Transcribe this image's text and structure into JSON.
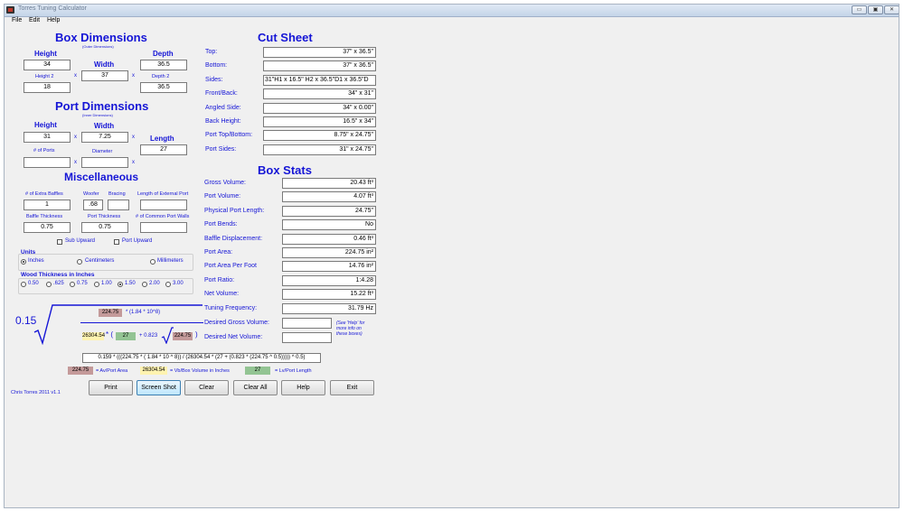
{
  "window": {
    "title": "Torres Tuning Calculator"
  },
  "menu": {
    "file": "File",
    "edit": "Edit",
    "help": "Help"
  },
  "box_dimensions": {
    "title": "Box Dimensions",
    "subtitle": "(Outer Dimensions)",
    "height_label": "Height",
    "height": "34",
    "width_label": "Width",
    "width": "37",
    "depth_label": "Depth",
    "depth": "36.5",
    "height2_label": "Height 2",
    "height2": "18",
    "depth2_label": "Depth 2",
    "depth2": "36.5",
    "x": "x"
  },
  "port_dimensions": {
    "title": "Port Dimensions",
    "subtitle": "(Inner Dimensions)",
    "height_label": "Height",
    "height": "31",
    "width_label": "Width",
    "width": "7.25",
    "length_label": "Length",
    "length": "27",
    "num_ports_label": "# of Ports",
    "num_ports": "",
    "diameter_label": "Diameter",
    "diameter": ""
  },
  "misc": {
    "title": "Miscellaneous",
    "extra_baffles_label": "# of Extra Baffles",
    "extra_baffles": "1",
    "woofer_label": "Woofer",
    "woofer": ".68",
    "bracing_label": "Bracing",
    "bracing": "",
    "ext_port_label": "Length of External Port",
    "ext_port": "",
    "baffle_thick_label": "Baffle Thickness",
    "baffle_thick": "0.75",
    "port_thick_label": "Port Thickness",
    "port_thick": "0.75",
    "common_walls_label": "# of Common Port Walls",
    "common_walls": "",
    "sub_upward": "Sub Upward",
    "port_upward": "Port Upward"
  },
  "units": {
    "title": "Units",
    "inches": "Inches",
    "centimeters": "Centimeters",
    "millimeters": "Millimeters",
    "selected": "Inches"
  },
  "wood": {
    "title": "Wood Thickness in Inches",
    "options": [
      "0.50",
      ".625",
      "0.75",
      "1.00",
      "1.50",
      "2.00",
      "3.00"
    ],
    "selected": "1.50"
  },
  "cut_sheet": {
    "title": "Cut Sheet",
    "rows": [
      {
        "label": "Top:",
        "value": "37\" x 36.5\""
      },
      {
        "label": "Bottom:",
        "value": "37\" x 36.5\""
      },
      {
        "label": "Sides:",
        "value": "31\"H1 x 16.5\" H2 x 36.5\"D1 x 36.5\"D"
      },
      {
        "label": "Front/Back:",
        "value": "34\" x 31\""
      },
      {
        "label": "Angled Side:",
        "value": "34\" x 0.00\""
      },
      {
        "label": "Back Height:",
        "value": "16.5\" x 34\""
      },
      {
        "label": "Port Top/Bottom:",
        "value": "8.75\" x 24.75\""
      },
      {
        "label": "Port Sides:",
        "value": "31\" x 24.75\""
      }
    ]
  },
  "box_stats": {
    "title": "Box Stats",
    "rows": [
      {
        "label": "Gross Volume:",
        "value": "20.43 ft³"
      },
      {
        "label": "Port Volume:",
        "value": "4.07 ft³"
      },
      {
        "label": "Physical Port Length:",
        "value": "24.75\""
      },
      {
        "label": "Port Bends:",
        "value": "No"
      },
      {
        "label": "Baffle Displacement:",
        "value": "0.46 ft³"
      },
      {
        "label": "Port Area:",
        "value": "224.75 in²"
      },
      {
        "label": "Port Area Per Foot",
        "value": "14.76 in²"
      },
      {
        "label": "Port Ratio:",
        "value": "1:4.28"
      },
      {
        "label": "Net Volume:",
        "value": "15.22 ft³"
      },
      {
        "label": "Tuning Frequency:",
        "value": "31.79 Hz"
      }
    ],
    "desired_gross_label": "Desired Gross Volume:",
    "desired_gross": "",
    "desired_net_label": "Desired Net Volume:",
    "desired_net": "",
    "help_note": [
      "(See 'Help' for",
      "more info on",
      "these boxes)"
    ]
  },
  "formula": {
    "coef": "0.15",
    "av_top": "224.75",
    "top_rest": "* (1.84 * 10^8)",
    "vb": "26304.54",
    "mult_paren": "* (",
    "lv": "27",
    "plus": "+ 0.823",
    "av_root": "224.75",
    "close": ")",
    "full": "0.159 * (((224.75 * ( 1.84 * 10 ^ 8)) / (26304.54 * (27 + (0.823 * (224.75 ^ 0.5))))) ^ 0.5)",
    "legend_av": "224.75",
    "legend_av_text": "= Av/Port Area",
    "legend_vb": "26304.54",
    "legend_vb_text": "= Vb/Box Volume in Inches",
    "legend_lv": "27",
    "legend_lv_text": "= Lv/Port Length"
  },
  "footer": {
    "credit": "Chris Torres 2011 v1.1"
  },
  "buttons": {
    "print": "Print",
    "screenshot": "Screen Shot",
    "clear": "Clear",
    "clear_all": "Clear All",
    "help": "Help",
    "exit": "Exit"
  }
}
